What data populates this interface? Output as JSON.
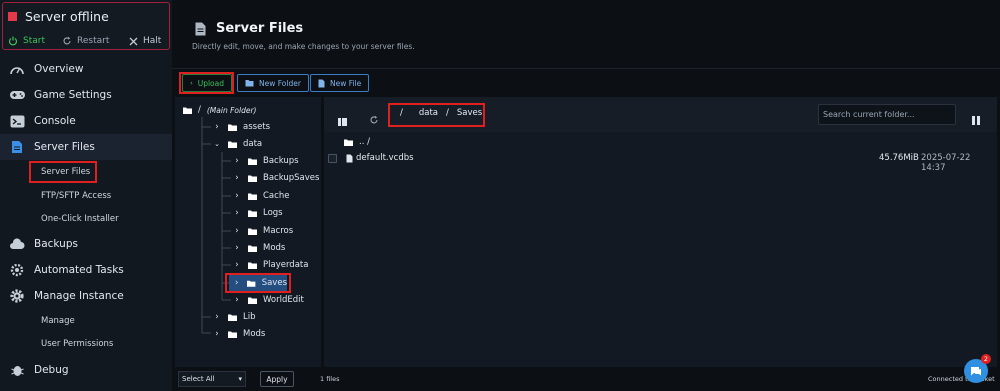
{
  "status": {
    "title": "Server offline",
    "start": "Start",
    "restart": "Restart",
    "halt": "Halt"
  },
  "nav": {
    "overview": "Overview",
    "game_settings": "Game Settings",
    "console": "Console",
    "server_files": "Server Files",
    "sub_files": [
      "Server Files",
      "FTP/SFTP Access",
      "One-Click Installer"
    ],
    "backups": "Backups",
    "automated_tasks": "Automated Tasks",
    "manage_instance": "Manage Instance",
    "sub_manage": [
      "Manage",
      "User Permissions"
    ],
    "debug": "Debug"
  },
  "header": {
    "title": "Server Files",
    "subtitle": "Directly edit, move, and make changes to your server files."
  },
  "toolbar": {
    "upload": "Upload",
    "new_folder": "New Folder",
    "new_file": "New File"
  },
  "tree": {
    "root": "/",
    "root_note": "(Main Folder)",
    "items": [
      "assets",
      "data",
      "Backups",
      "BackupSaves",
      "Cache",
      "Logs",
      "Macros",
      "Mods",
      "Playerdata",
      "Saves",
      "WorldEdit",
      "Lib",
      "Mods"
    ]
  },
  "list": {
    "crumb_root": "/",
    "crumb_1": "data",
    "crumb_sep": "/",
    "crumb_2": "Saves",
    "search_placeholder": "Search current folder...",
    "parent": ".. /",
    "file": {
      "name": "default.vcdbs",
      "size": "45.76MiB",
      "date": "2025-07-22 14:37"
    }
  },
  "footer": {
    "select": "Select All",
    "apply": "Apply",
    "count": "1 files",
    "connection": "Connected to socket",
    "badge": "2"
  },
  "colors": {
    "accent": "#3b7dc4",
    "success": "#3cc35a",
    "danger": "#e0201f",
    "folder": "#ffffff"
  }
}
